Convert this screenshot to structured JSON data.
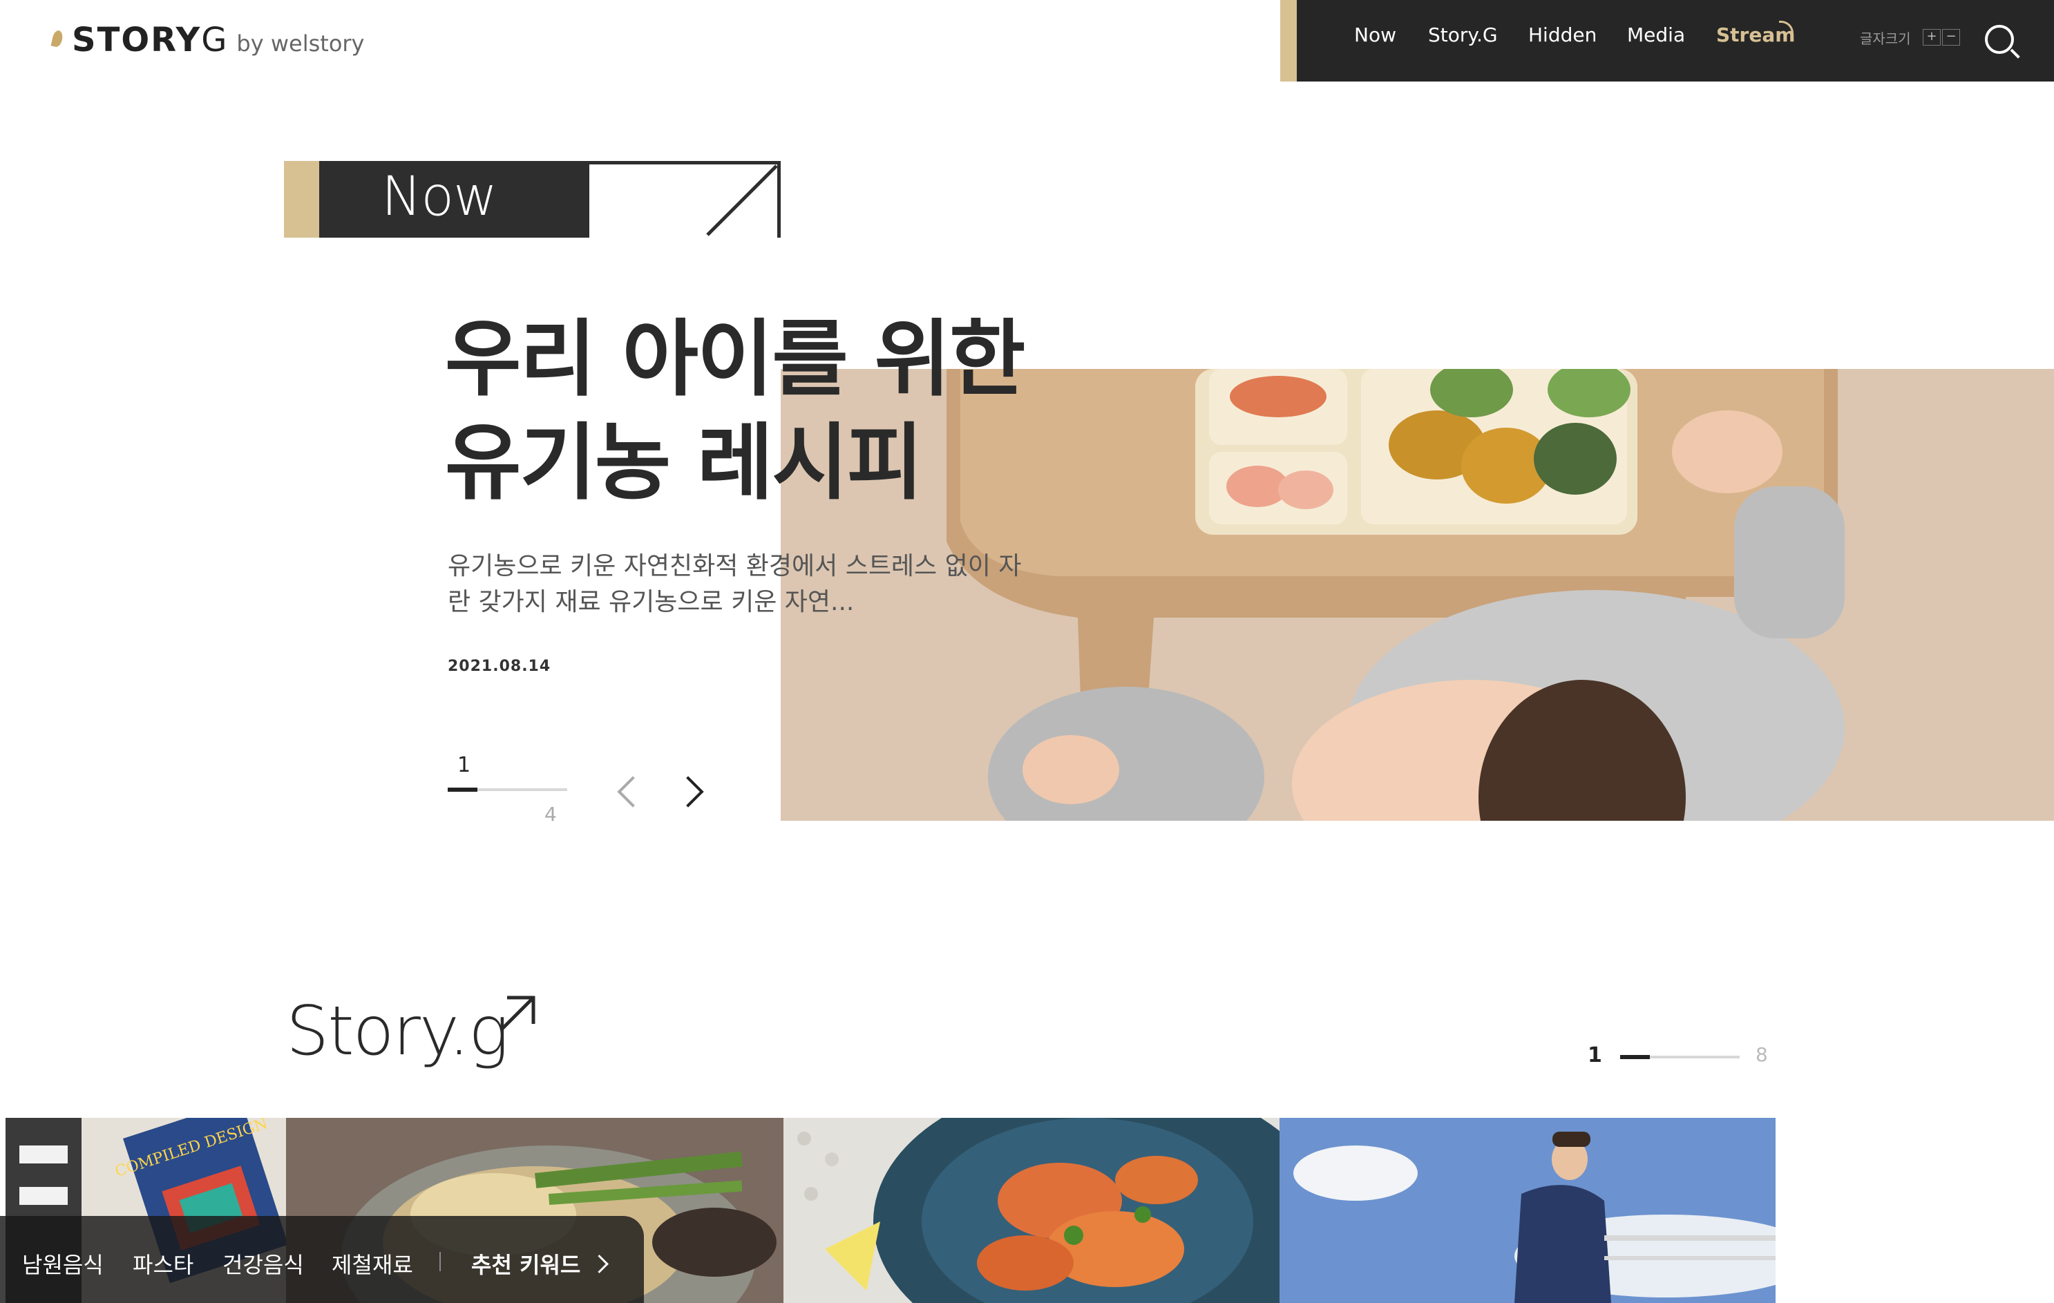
{
  "header": {
    "logo_brand": "STORY",
    "logo_g": "G",
    "logo_by": "by welstory",
    "nav": [
      "Now",
      "Story.G",
      "Hidden",
      "Media",
      "Stream"
    ],
    "font_size_label": "글자크기",
    "font_plus": "+",
    "font_minus": "−"
  },
  "now": {
    "label": "Now",
    "title_line1": "우리 아이를 위한",
    "title_line2": "유기농 레시피",
    "description": "유기농으로 키운 자연친화적 환경에서 스트레스 없이 자란 갖가지 재료 유기농으로 키운 자연...",
    "date": "2021.08.14",
    "page_current": "1",
    "page_total": "4",
    "progress": 0.25
  },
  "story": {
    "title": "Story.g",
    "page_current": "1",
    "page_total": "8",
    "progress": 0.25,
    "book_text": "COMPILED DESIGN"
  },
  "keywords": {
    "items": [
      "남원음식",
      "파스타",
      "건강음식",
      "제철재료"
    ],
    "recommend": "추천 키워드"
  },
  "colors": {
    "gold": "#d7c193",
    "dark": "#262626"
  }
}
